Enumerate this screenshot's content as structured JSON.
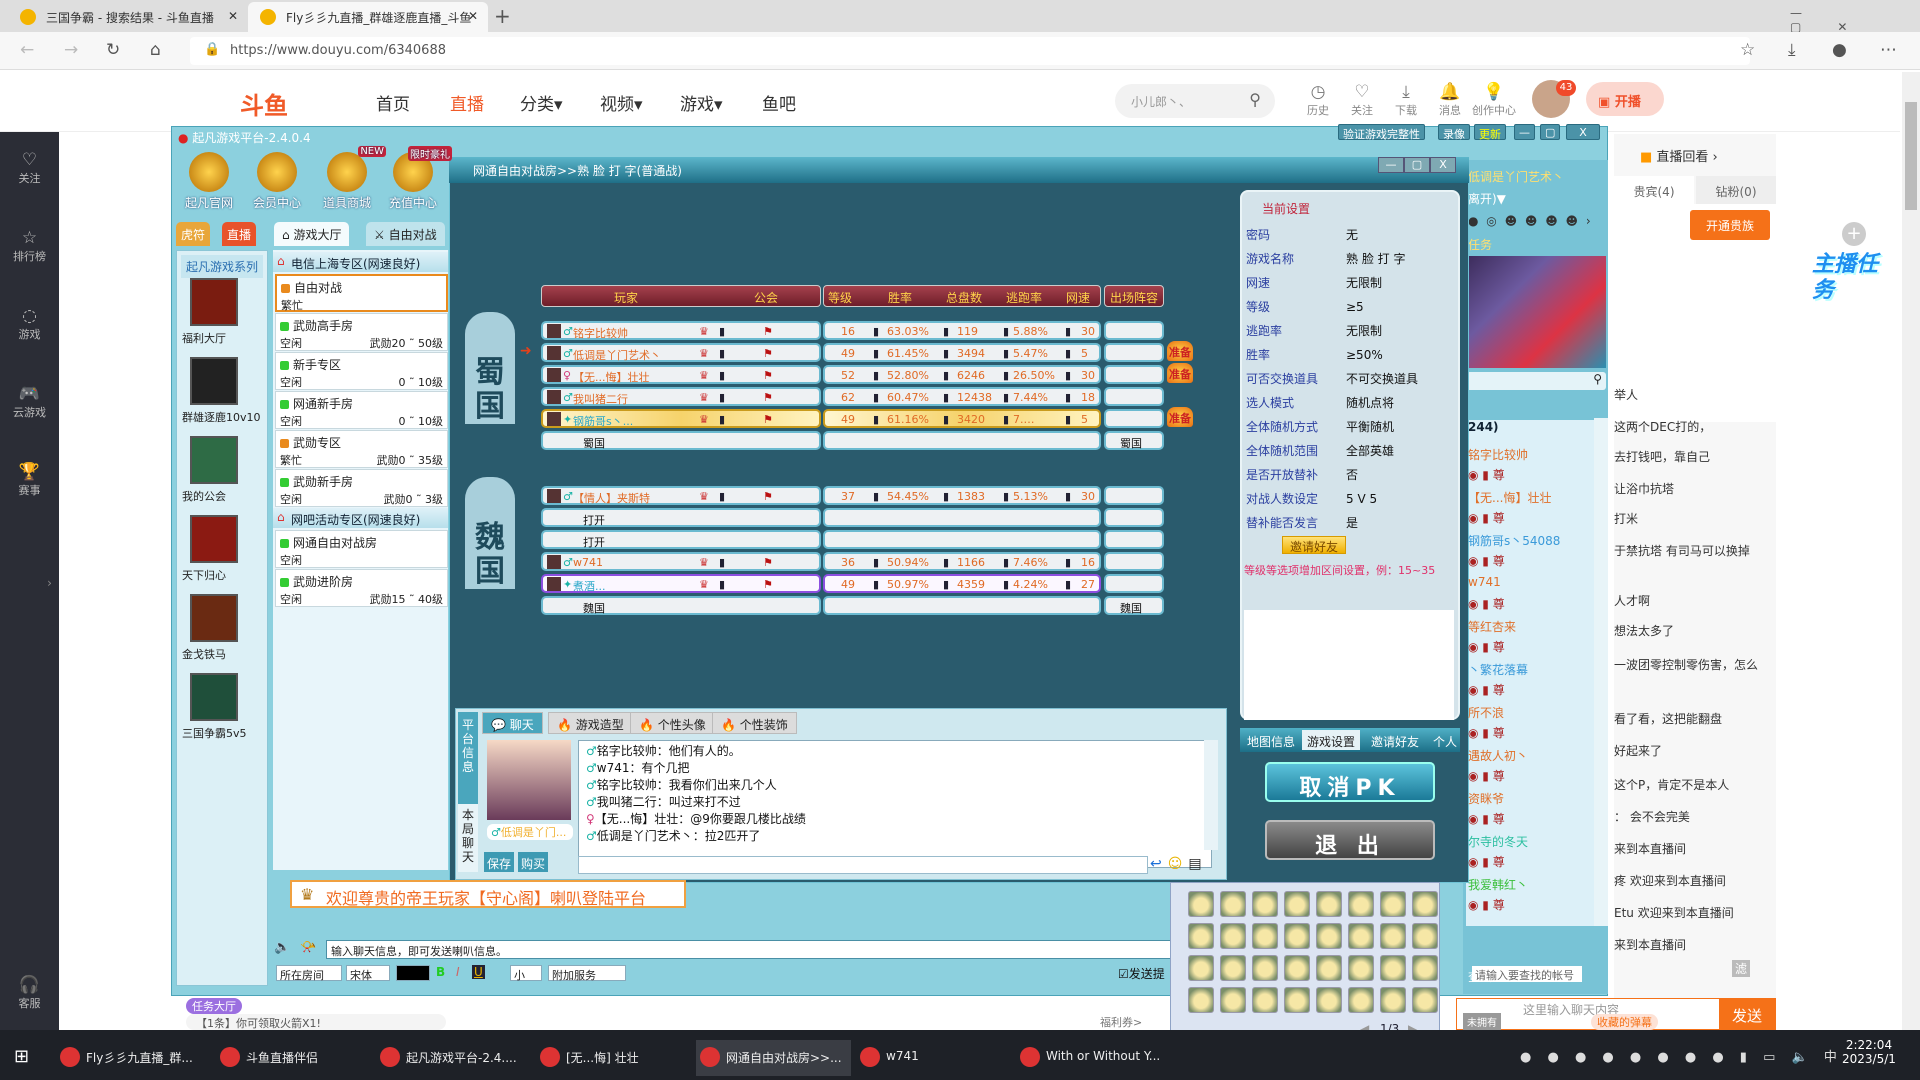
{
  "browser": {
    "tabs": [
      {
        "title": "三国争霸 - 搜索结果 - 斗鱼直播"
      },
      {
        "title": "Fly彡彡九直播_群雄逐鹿直播_斗鱼"
      }
    ],
    "url": "https://www.douyu.com/6340688"
  },
  "douyu": {
    "nav": [
      "首页",
      "直播",
      "分类▾",
      "视频▾",
      "游戏▾",
      "鱼吧"
    ],
    "search_placeholder": "小儿郎丶、",
    "header_icons": [
      {
        "icon": "clock-icon",
        "label": "历史"
      },
      {
        "icon": "heart-icon",
        "label": "关注"
      },
      {
        "icon": "download-icon",
        "label": "下载"
      },
      {
        "icon": "bell-icon",
        "label": "消息"
      },
      {
        "icon": "bulb-icon",
        "label": "创作中心"
      }
    ],
    "notif_count": "43",
    "start_stream": "开播",
    "sidebar": [
      {
        "icon": "heart-icon",
        "label": "关注"
      },
      {
        "icon": "ranking-icon",
        "label": "排行榜"
      },
      {
        "icon": "game-icon",
        "label": "游戏"
      },
      {
        "icon": "gamepad-icon",
        "label": "云游戏"
      },
      {
        "icon": "trophy-icon",
        "label": "赛事"
      },
      {
        "icon": "headset-icon",
        "label": "客服"
      }
    ],
    "replay": "直播回看 ›",
    "tabs": [
      "贵宾(4)",
      "钻粉(0)"
    ],
    "open_noble": "开通贵族",
    "task_badge": "主播任务",
    "chat": [
      "举人",
      "这两个DEC打的，",
      "去打钱吧，靠自己",
      "让浴巾抗塔",
      "打米",
      "于禁抗塔 有司马可以换掉",
      "人才啊",
      "想法太多了",
      "一波团零控制零伤害，怎么",
      "看了看，这把能翻盘",
      "好起来了",
      "这个P，肯定不是本人",
      "：  会不会完美",
      "来到本直播间",
      "疼 欢迎来到本直播间",
      "Etu 欢迎来到本直播间",
      "来到本直播间"
    ],
    "chat_placeholder": "这里输入聊天内容",
    "fav_danmu": "收藏的弹幕",
    "send": "发送",
    "not_owned": "未拥有",
    "filter": "滤",
    "bottom": {
      "task_hall": "任务大厅",
      "notice": "【1条】你可领取火箭X1!",
      "coupon": "福利券>"
    }
  },
  "platform": {
    "title": "起凡游戏平台-2.4.0.4",
    "top_buttons": [
      "验证游戏完整性",
      "录像",
      "更新"
    ],
    "top_icons": [
      {
        "label": "起凡官网"
      },
      {
        "label": "会员中心"
      },
      {
        "label": "道具商城",
        "tag": "NEW"
      },
      {
        "label": "充值中心",
        "tag": "限时豪礼"
      }
    ],
    "side_tabs": [
      "虎符",
      "直播"
    ],
    "tabs": [
      "游戏大厅",
      "自由对战"
    ],
    "series_title": "起凡游戏系列",
    "games": [
      "福利大厅",
      "群雄逐鹿10v10",
      "我的公会",
      "天下归心",
      "金戈铁马",
      "三国争霸5v5"
    ],
    "zones": [
      {
        "name": "电信上海专区(网速良好)",
        "rooms": [
          {
            "name": "自由对战",
            "status": "繁忙",
            "range": "",
            "busy": true,
            "selected": true
          },
          {
            "name": "武勋高手房",
            "status": "空闲",
            "range": "武勋20 ˜ 50级"
          },
          {
            "name": "新手专区",
            "status": "空闲",
            "range": "0 ˜ 10级"
          },
          {
            "name": "网通新手房",
            "status": "空闲",
            "range": "0 ˜ 10级"
          },
          {
            "name": "武勋专区",
            "status": "繁忙",
            "range": "武勋0 ˜ 35级",
            "busy": true
          },
          {
            "name": "武勋新手房",
            "status": "空闲",
            "range": "武勋0 ˜ 3级"
          }
        ]
      },
      {
        "name": "网吧活动专区(网速良好)",
        "rooms": [
          {
            "name": "网通自由对战房",
            "status": "空闲",
            "range": ""
          },
          {
            "name": "武勋进阶房",
            "status": "空闲",
            "range": "武勋15 ˜ 40级"
          }
        ]
      }
    ],
    "welcome": "欢迎尊贵的帝王玩家【守心阁】喇叭登陆平台",
    "chat_placeholder": "输入聊天信息，即可发送喇叭信息。",
    "toolbar": [
      "所在房间",
      "宋体",
      "小",
      "附加服务"
    ],
    "send_hint": "发送提",
    "friends": {
      "name": "低调是丫门艺术丶",
      "status": "离开)▼",
      "task": "任务",
      "count": "244)",
      "search_label": "查找",
      "search_placeholder": "请输入要查找的帐号",
      "list": [
        {
          "name": "铭字比较帅",
          "color": "#e0702a"
        },
        {
          "name": "【无...悔】壮壮",
          "color": "#e0702a"
        },
        {
          "name": "钢筋哥s丶54088",
          "color": "#3a9ad9"
        },
        {
          "name": "w741",
          "color": "#e0702a"
        },
        {
          "name": "等红杏来",
          "color": "#e0702a"
        },
        {
          "name": "丶繁花落幕",
          "color": "#3a9ad9"
        },
        {
          "name": "所不浪",
          "color": "#e0702a"
        },
        {
          "name": "遇故人初丶",
          "color": "#e0702a"
        },
        {
          "name": "资眯爷",
          "color": "#e0702a"
        },
        {
          "name": "尔寺的冬天",
          "color": "#2bbfa0"
        },
        {
          "name": "我爱韩红丶",
          "color": "#3bbf3b"
        }
      ]
    }
  },
  "room": {
    "title": "网通自由对战房>>熟 脸 打 字(普通战)",
    "headers": [
      "玩家",
      "公会",
      "等级",
      "胜率",
      "总盘数",
      "逃跑率",
      "网速",
      "出场阵容"
    ],
    "teams": [
      {
        "name": "蜀国",
        "players": [
          {
            "name": "铭字比较帅",
            "gender": "male",
            "level": "16",
            "win": "63.03%",
            "total": "119",
            "escape": "5.88%",
            "ping": "30",
            "ready": false
          },
          {
            "name": "低调是丫门艺术丶",
            "gender": "male",
            "level": "49",
            "win": "61.45%",
            "total": "3494",
            "escape": "5.47%",
            "ping": "5",
            "ready": true,
            "me": true
          },
          {
            "name": "【无...悔】壮壮",
            "gender": "female",
            "level": "52",
            "win": "52.80%",
            "total": "6246",
            "escape": "26.50%",
            "ping": "30",
            "ready": true
          },
          {
            "name": "我叫猪二行",
            "gender": "male",
            "level": "62",
            "win": "60.47%",
            "total": "12438",
            "escape": "7.44%",
            "ping": "18",
            "ready": false
          },
          {
            "name": "钢筋哥s丶...",
            "gender": "vip",
            "level": "49",
            "win": "61.16%",
            "total": "3420",
            "escape": "7.…",
            "ping": "5",
            "ready": true,
            "style": "gold"
          }
        ]
      },
      {
        "name": "魏国",
        "players": [
          {
            "name": "【情人】夹斯特",
            "gender": "male",
            "level": "37",
            "win": "54.45%",
            "total": "1383",
            "escape": "5.13%",
            "ping": "30"
          },
          {
            "open": "打开"
          },
          {
            "open": "打开"
          },
          {
            "name": "w741",
            "gender": "male",
            "level": "36",
            "win": "50.94%",
            "total": "1166",
            "escape": "7.46%",
            "ping": "16"
          },
          {
            "name": "煮酒...",
            "gender": "vip",
            "level": "49",
            "win": "50.97%",
            "total": "4359",
            "escape": "4.24%",
            "ping": "27",
            "style": "purple"
          }
        ]
      }
    ],
    "ready_label": "准备",
    "settings": {
      "title": "当前设置",
      "rows": [
        [
          "密码",
          "无"
        ],
        [
          "游戏名称",
          "熟 脸 打 字"
        ],
        [
          "网速",
          "无限制"
        ],
        [
          "等级",
          "≥5"
        ],
        [
          "逃跑率",
          "无限制"
        ],
        [
          "胜率",
          "≥50%"
        ],
        [
          "可否交换道具",
          "不可交换道具"
        ],
        [
          "选人模式",
          "随机点将"
        ],
        [
          "全体随机方式",
          "平衡随机"
        ],
        [
          "全体随机范围",
          "全部英雄"
        ],
        [
          "是否开放替补",
          "否"
        ],
        [
          "对战人数设定",
          "5 V 5"
        ],
        [
          "替补能否发言",
          "是"
        ]
      ],
      "invite": "邀请好友",
      "hint": "等级等选项增加区间设置，例：15~35",
      "tabs": [
        "地图信息",
        "游戏设置",
        "邀请好友",
        "个人"
      ]
    },
    "cancel_pk": "取消PK",
    "exit": "退 出",
    "chat": {
      "side_tabs": [
        "平台信息",
        "本局聊天"
      ],
      "tabs": [
        "聊天",
        "游戏造型",
        "个性头像",
        "个性装饰"
      ],
      "avatar_name": "低调是丫门...",
      "save": "保存",
      "buy": "购买",
      "messages": [
        {
          "gender": "male",
          "user": "铭字比较帅",
          "text": "他们有人的。"
        },
        {
          "gender": "male",
          "user": "w741",
          "text": "有个几把"
        },
        {
          "gender": "male",
          "user": "铭字比较帅",
          "text": "我看你们出来几个人"
        },
        {
          "gender": "male",
          "user": "我叫猪二行",
          "text": "叫过来打不过"
        },
        {
          "gender": "female",
          "user": "【无...悔】壮壮",
          "text": "@9你要跟几楼比战绩"
        },
        {
          "gender": "male",
          "user": "低调是丫门艺术丶",
          "text": "拉2匹开了"
        }
      ]
    }
  },
  "emoji": {
    "page": "1/3"
  },
  "taskbar": {
    "items": [
      "Fly彡彡九直播_群...",
      "斗鱼直播伴侣",
      "起凡游戏平台-2.4....",
      "[无...悔] 壮壮",
      "网通自由对战房>>...",
      "w741",
      "With or Without Y..."
    ],
    "active": 4,
    "time": "2:22:04",
    "date": "2023/5/1",
    "ime": "中"
  },
  "colors": {
    "douyu_orange": "#ff7a1a",
    "platform_teal": "#8cd0de",
    "room_bg": "#2a5b6d",
    "header_red": "#8b2f3a"
  }
}
